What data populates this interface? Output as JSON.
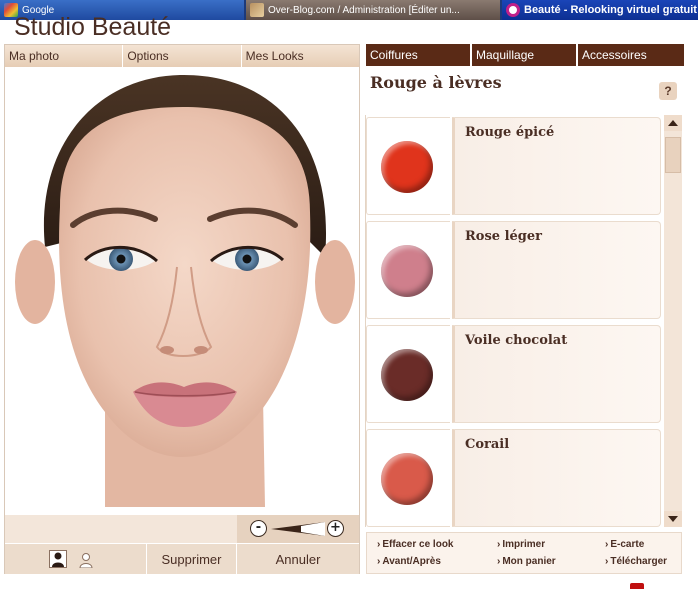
{
  "browser": {
    "tabs": [
      {
        "label": "Google"
      },
      {
        "label": "Over-Blog.com / Administration [Éditer un..."
      },
      {
        "label": "Beauté - Relooking virtuel gratuit"
      }
    ]
  },
  "app": {
    "title": "Studio Beauté"
  },
  "left_tabs": [
    "Ma photo",
    "Options",
    "Mes Looks"
  ],
  "bottom_bar": {
    "delete_label": "Supprimer",
    "cancel_label": "Annuler"
  },
  "zoom": {
    "minus": "-",
    "plus": "+"
  },
  "right_tabs": [
    "Coiffures",
    "Maquillage",
    "Accessoires"
  ],
  "section": {
    "title": "Rouge à lèvres",
    "help": "?"
  },
  "products": [
    {
      "name": "Rouge épicé",
      "color": "#e0341c"
    },
    {
      "name": "Rose léger",
      "color": "#cf7f8c"
    },
    {
      "name": "Voile chocolat",
      "color": "#6a2c28"
    },
    {
      "name": "Corail",
      "color": "#d95a4a"
    }
  ],
  "links": [
    "Effacer ce look",
    "Imprimer",
    "E-carte",
    "Avant/Après",
    "Mon panier",
    "Télécharger"
  ]
}
